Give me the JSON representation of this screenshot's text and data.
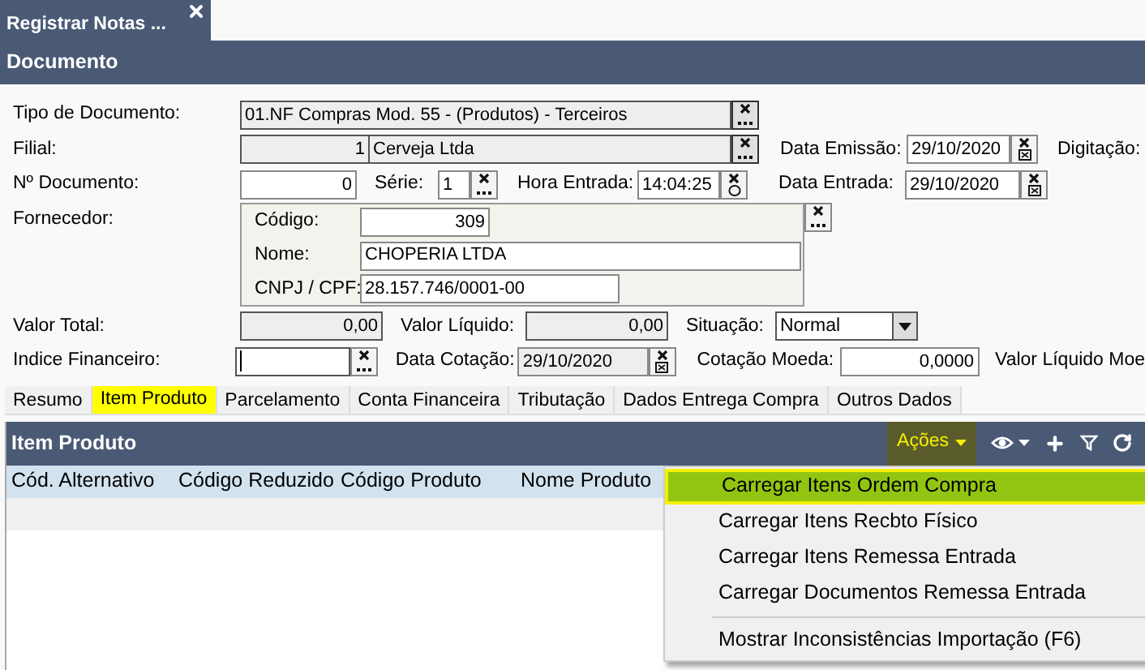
{
  "window_tabs": [
    {
      "label": "Registrar Notas ...",
      "selected": true
    }
  ],
  "section_title": "Documento",
  "form": {
    "tipo_documento": {
      "label": "Tipo de Documento:",
      "value": "01.NF Compras Mod. 55 - (Produtos) - Terceiros",
      "readonly": true
    },
    "filial": {
      "label": "Filial:",
      "code": "1",
      "name": "Cerveja Ltda",
      "readonly": true
    },
    "data_emissao": {
      "label": "Data Emissão:",
      "value": "29/10/2020",
      "readonly": false
    },
    "digitacao": {
      "label": "Digitação:"
    },
    "numero_documento": {
      "label": "Nº Documento:",
      "value": "0",
      "readonly": false
    },
    "serie": {
      "label": "Série:",
      "value": "1",
      "readonly": false
    },
    "hora_entrada": {
      "label": "Hora Entrada:",
      "value": "14:04:25",
      "readonly": false
    },
    "data_entrada": {
      "label": "Data Entrada:",
      "value": "29/10/2020",
      "readonly": false
    },
    "fornecedor": {
      "label": "Fornecedor:",
      "codigo_label": "Código:",
      "codigo": "309",
      "nome_label": "Nome:",
      "nome": "CHOPERIA LTDA",
      "cnpj_label": "CNPJ / CPF:",
      "cnpj": "28.157.746/0001-00"
    },
    "valor_total": {
      "label": "Valor Total:",
      "value": "0,00",
      "readonly": true
    },
    "valor_liquido": {
      "label": "Valor Líquido:",
      "value": "0,00",
      "readonly": true
    },
    "situacao": {
      "label": "Situação:",
      "value": "Normal"
    },
    "indice_financeiro": {
      "label": "Indice Financeiro:",
      "readonly": false
    },
    "data_cotacao": {
      "label": "Data Cotação:",
      "value": "29/10/2020",
      "readonly": true
    },
    "cotacao_moeda": {
      "label": "Cotação Moeda:",
      "value": "0,0000",
      "readonly": false
    },
    "valor_liquido_moeda": {
      "label": "Valor Líquido Moe"
    }
  },
  "detail_tabs": [
    {
      "label": "Resumo",
      "selected": false
    },
    {
      "label": "Item Produto",
      "selected": true
    },
    {
      "label": "Parcelamento",
      "selected": false
    },
    {
      "label": "Conta Financeira",
      "selected": false
    },
    {
      "label": "Tributação",
      "selected": false
    },
    {
      "label": "Dados Entrega Compra",
      "selected": false
    },
    {
      "label": "Outros Dados",
      "selected": false
    }
  ],
  "panel": {
    "title": "Item Produto",
    "actions_label": "Ações",
    "columns": [
      "Cód. Alternativo",
      "Código Reduzido",
      "Código Produto",
      "Nome Produto"
    ],
    "menu_groups": [
      [
        {
          "label": "Carregar Itens Ordem Compra",
          "selected": true
        },
        {
          "label": "Carregar Itens Recbto Físico",
          "selected": false
        },
        {
          "label": "Carregar Itens Remessa Entrada",
          "selected": false
        },
        {
          "label": "Carregar Documentos Remessa Entrada",
          "selected": false
        }
      ],
      [
        {
          "label": "Mostrar Inconsistências Importação (F6)",
          "selected": false
        }
      ]
    ]
  }
}
